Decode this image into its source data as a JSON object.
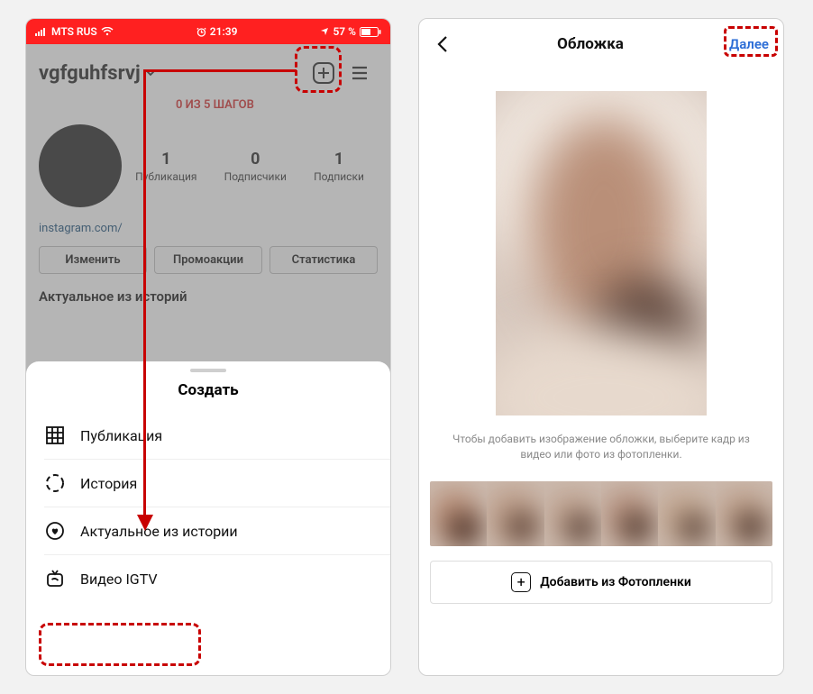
{
  "left": {
    "statusbar": {
      "carrier": "MTS RUS",
      "time": "21:39",
      "battery_pct": "57 %"
    },
    "username": "vgfguhfsrvj",
    "progress": "0 ИЗ 5 ШАГОВ",
    "stats": {
      "posts": {
        "num": "1",
        "label": "Публикация"
      },
      "followers": {
        "num": "0",
        "label": "Подписчики"
      },
      "following": {
        "num": "1",
        "label": "Подписки"
      }
    },
    "site": "instagram.com/",
    "buttons": {
      "edit": "Изменить",
      "promo": "Промоакции",
      "stats": "Статистика"
    },
    "highlights_title": "Актуальное из историй",
    "sheet": {
      "title": "Создать",
      "items": {
        "post": "Публикация",
        "story": "История",
        "highlight": "Актуальное из истории",
        "igtv": "Видео IGTV"
      }
    }
  },
  "right": {
    "title": "Обложка",
    "next": "Далее",
    "hint": "Чтобы добавить изображение обложки, выберите кадр из видео или фото из фотопленки.",
    "add_from_roll": "Добавить из Фотопленки"
  }
}
